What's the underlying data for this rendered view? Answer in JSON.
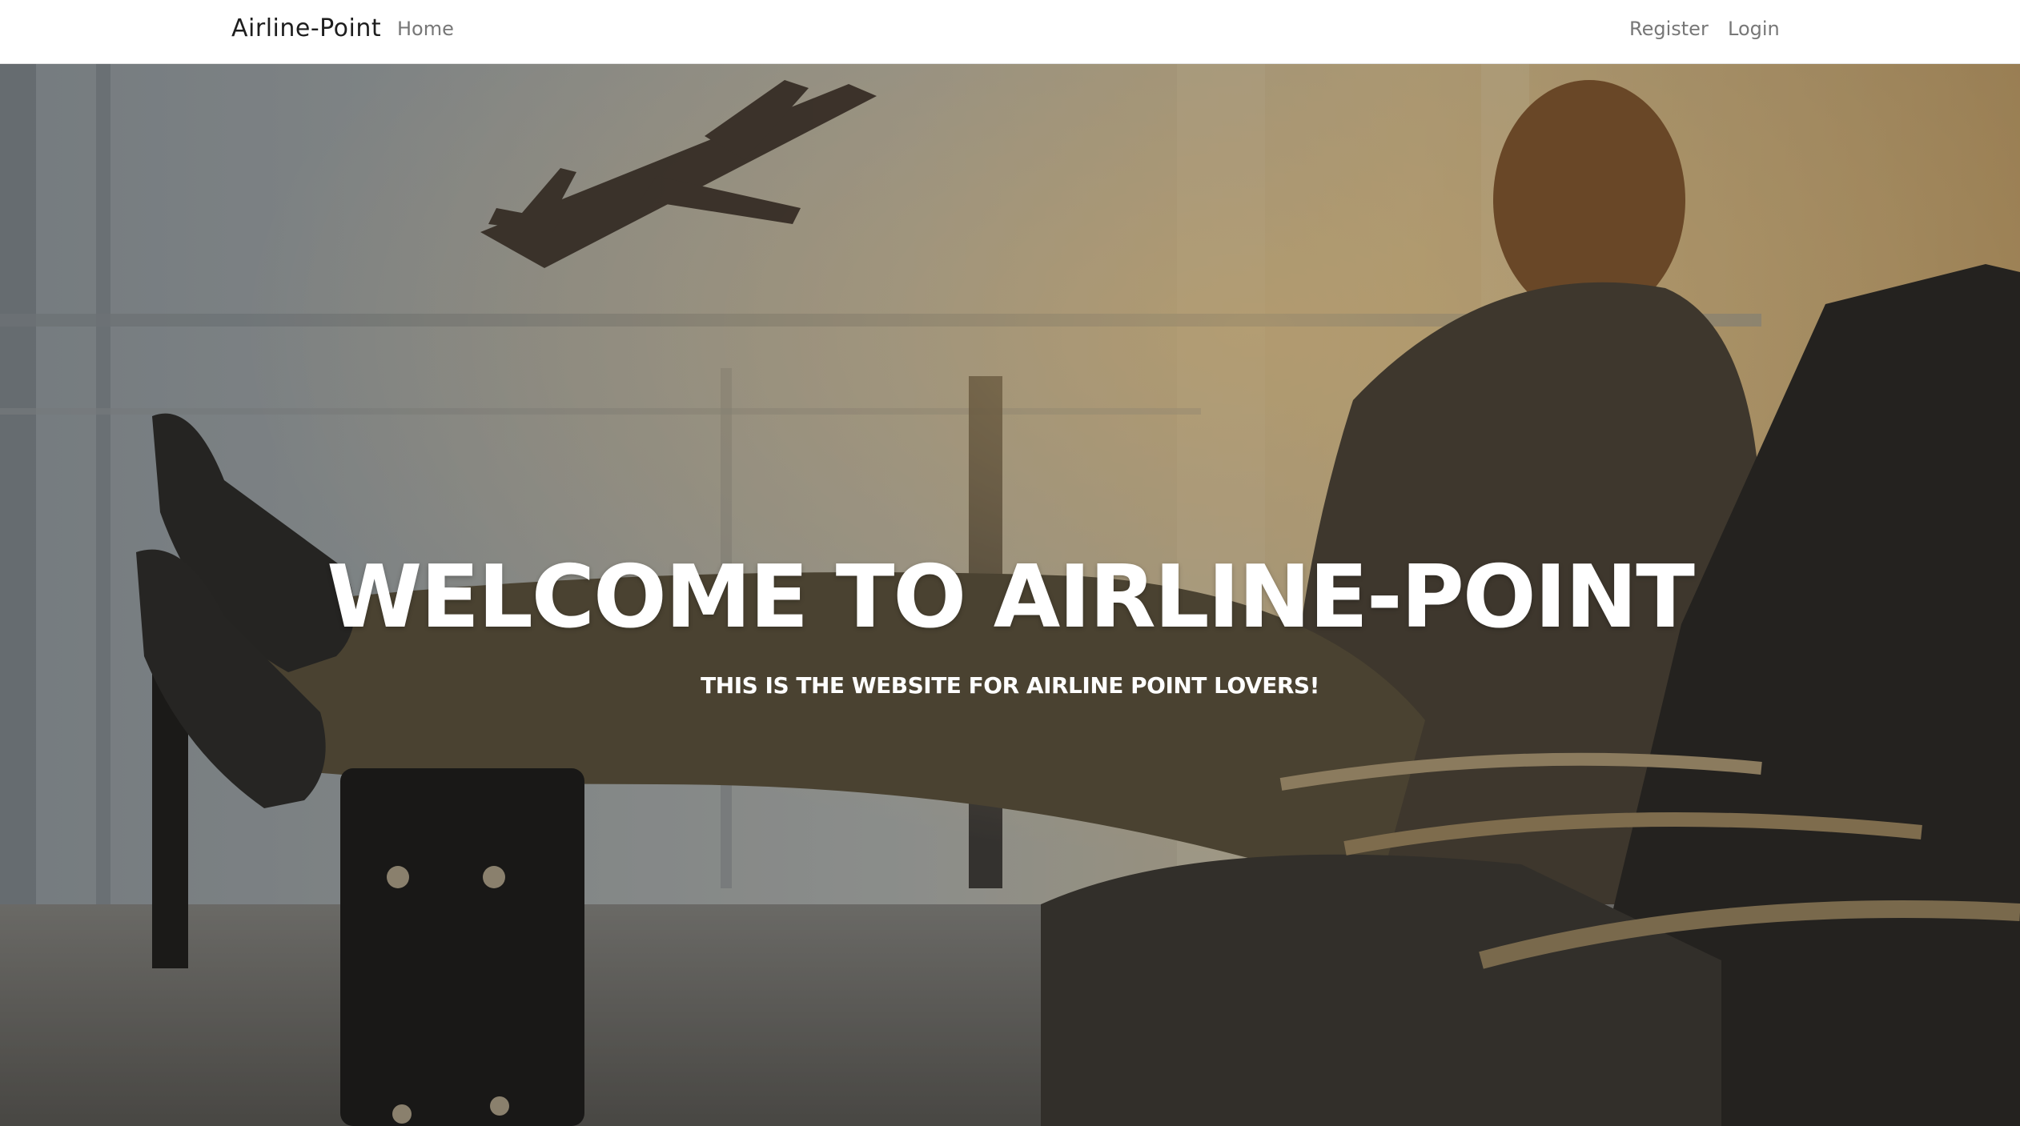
{
  "navbar": {
    "brand": "Airline-Point",
    "links": {
      "home": "Home",
      "register": "Register",
      "login": "Login"
    }
  },
  "hero": {
    "title": "WELCOME TO AIRLINE-POINT",
    "subtitle": "THIS IS THE WEBSITE FOR AIRLINE POINT LOVERS!",
    "background_image": "traveler-in-airport-lounge-photo"
  },
  "colors": {
    "navbar_bg": "#ffffff",
    "brand_text": "#1e1e1e",
    "nav_link": "#777777",
    "hero_text": "#ffffff"
  }
}
